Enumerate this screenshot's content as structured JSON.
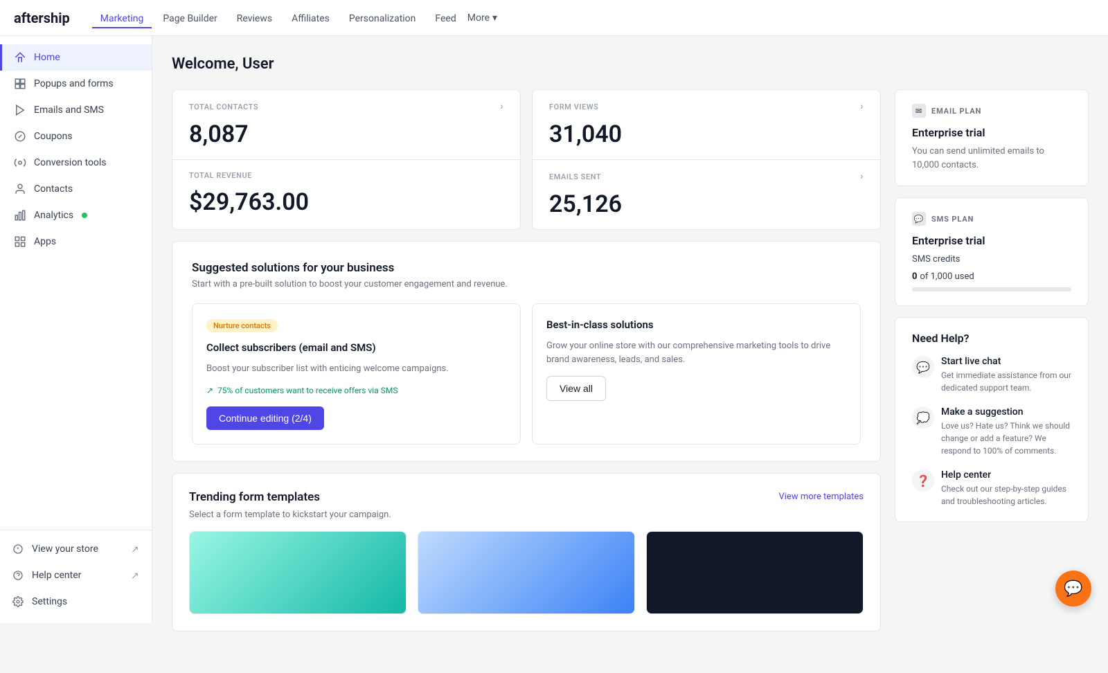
{
  "logo": {
    "text": "aftership",
    "brand_color": "#4f46e5"
  },
  "topnav": {
    "links": [
      {
        "id": "marketing",
        "label": "Marketing",
        "active": true
      },
      {
        "id": "page-builder",
        "label": "Page Builder",
        "active": false
      },
      {
        "id": "reviews",
        "label": "Reviews",
        "active": false
      },
      {
        "id": "affiliates",
        "label": "Affiliates",
        "active": false
      },
      {
        "id": "personalization",
        "label": "Personalization",
        "active": false
      },
      {
        "id": "feed",
        "label": "Feed",
        "active": false
      }
    ],
    "more_label": "More"
  },
  "sidebar": {
    "items": [
      {
        "id": "home",
        "label": "Home",
        "icon": "🏠",
        "active": true
      },
      {
        "id": "popups",
        "label": "Popups and forms",
        "icon": "⊞",
        "active": false
      },
      {
        "id": "emails",
        "label": "Emails and SMS",
        "icon": "▷",
        "active": false
      },
      {
        "id": "coupons",
        "label": "Coupons",
        "icon": "🎁",
        "active": false
      },
      {
        "id": "conversion",
        "label": "Conversion tools",
        "icon": "⚙",
        "active": false
      },
      {
        "id": "contacts",
        "label": "Contacts",
        "icon": "👤",
        "active": false
      },
      {
        "id": "analytics",
        "label": "Analytics",
        "icon": "📊",
        "active": false,
        "has_badge": true
      },
      {
        "id": "apps",
        "label": "Apps",
        "icon": "⊞",
        "active": false
      }
    ],
    "bottom_items": [
      {
        "id": "view-store",
        "label": "View your store",
        "icon": "👁",
        "external": true
      },
      {
        "id": "help-center",
        "label": "Help center",
        "icon": "?",
        "external": true
      },
      {
        "id": "settings",
        "label": "Settings",
        "icon": "⚙",
        "external": false
      }
    ]
  },
  "main": {
    "welcome_title": "Welcome, User",
    "stats": {
      "total_contacts": {
        "label": "TOTAL CONTACTS",
        "value": "8,087"
      },
      "total_revenue": {
        "label": "TOTAL REVENUE",
        "value": "$29,763.00"
      },
      "form_views": {
        "label": "FORM VIEWS",
        "value": "31,040"
      },
      "emails_sent": {
        "label": "EMAILS SENT",
        "value": "25,126"
      }
    },
    "email_plan": {
      "header": "EMAIL PLAN",
      "title": "Enterprise trial",
      "description": "You can send unlimited emails to 10,000 contacts."
    },
    "sms_plan": {
      "header": "SMS PLAN",
      "title": "Enterprise trial",
      "credits_label": "SMS credits",
      "credits_used": "0",
      "credits_total": "1,000",
      "credits_text": "of 1,000 used"
    },
    "need_help": {
      "title": "Need Help?",
      "items": [
        {
          "id": "live-chat",
          "icon": "💬",
          "title": "Start live chat",
          "description": "Get immediate assistance from our dedicated support team."
        },
        {
          "id": "suggestion",
          "icon": "💭",
          "title": "Make a suggestion",
          "description": "Love us? Hate us? Think we should change or add a feature? We respond to 100% of comments."
        },
        {
          "id": "help-center",
          "icon": "❓",
          "title": "Help center",
          "description": "Check out our step-by-step guides and troubleshooting articles."
        }
      ]
    },
    "solutions": {
      "title": "Suggested solutions for your business",
      "description": "Start with a pre-built solution to boost your customer engagement and revenue.",
      "card1": {
        "badge": "Nurture contacts",
        "title": "Collect subscribers (email and SMS)",
        "description": "Boost your subscriber list with enticing welcome campaigns.",
        "stat": "75% of customers want to receive offers via SMS",
        "cta_label": "Continue editing (2/4)"
      },
      "card2": {
        "title": "Best-in-class solutions",
        "description": "Grow your online store with our comprehensive marketing tools to drive brand awareness, leads, and sales.",
        "view_all_label": "View all"
      }
    },
    "trending": {
      "title": "Trending form templates",
      "description": "Select a form template to kickstart your campaign.",
      "view_more_label": "View more templates"
    }
  },
  "chat_fab": {
    "icon": "💬"
  }
}
